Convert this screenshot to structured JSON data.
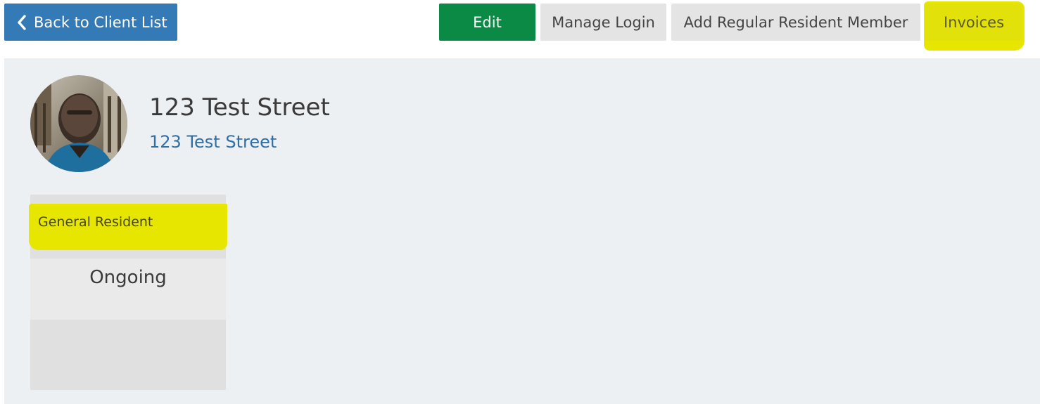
{
  "toolbar": {
    "back_label": "Back to Client List",
    "edit_label": "Edit",
    "manage_login_label": "Manage Login",
    "add_member_label": "Add Regular Resident Member",
    "invoices_label": "Invoices"
  },
  "profile": {
    "title": "123 Test Street",
    "subtitle": "123 Test Street"
  },
  "card": {
    "header": "General Resident",
    "status": "Ongoing"
  },
  "colors": {
    "back_button": "#337ab7",
    "edit_button": "#0a8a44",
    "secondary_button": "#e4e4e4",
    "highlight": "#e6e600",
    "panel_background": "#ecf0f3",
    "link": "#2f6fa6"
  },
  "icons": {
    "back": "chevron-left-icon",
    "avatar": "user-photo"
  }
}
